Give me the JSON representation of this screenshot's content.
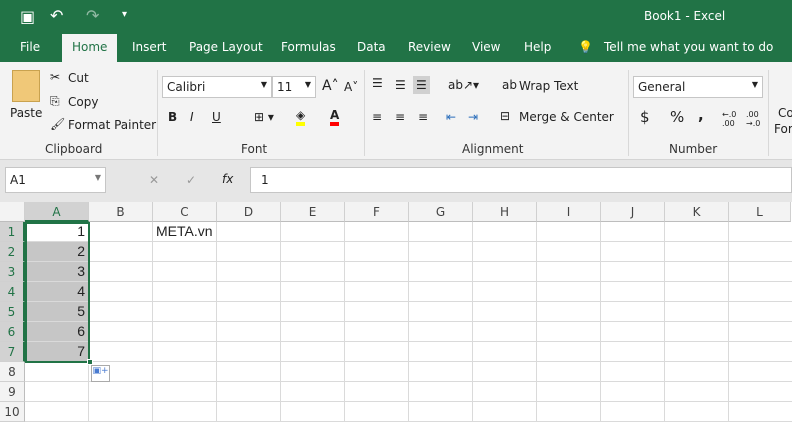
{
  "title": "Book1  -  Excel",
  "qat": {
    "save": "save-icon",
    "undo": "undo-icon",
    "redo": "redo-icon",
    "customize": "▾"
  },
  "tabs": [
    "File",
    "Home",
    "Insert",
    "Page Layout",
    "Formulas",
    "Data",
    "Review",
    "View",
    "Help"
  ],
  "tell_me": "Tell me what you want to do",
  "clipboard": {
    "paste": "Paste",
    "cut": "Cut",
    "copy": "Copy",
    "format_painter": "Format Painter",
    "label": "Clipboard"
  },
  "font": {
    "name": "Calibri",
    "size": "11",
    "label": "Font",
    "bold": "B",
    "italic": "I",
    "underline": "U",
    "fill_color": "#ffff00",
    "font_color": "#ff0000"
  },
  "alignment": {
    "wrap": "Wrap Text",
    "merge": "Merge & Center",
    "label": "Alignment"
  },
  "number": {
    "format": "General",
    "currency": "$",
    "percent": "%",
    "comma": ",",
    "label": "Number",
    "inc": "←.0 .00",
    "dec": ".00 →.0"
  },
  "styles": {
    "cond": "Co",
    "cond2": "For"
  },
  "formula_bar": {
    "name_box": "A1",
    "fx": "fx",
    "value": "1",
    "cancel": "✕",
    "enter": "✓"
  },
  "columns": [
    "A",
    "B",
    "C",
    "D",
    "E",
    "F",
    "G",
    "H",
    "I",
    "J",
    "K",
    "L"
  ],
  "rows": [
    "1",
    "2",
    "3",
    "4",
    "5",
    "6",
    "7",
    "8",
    "9",
    "10"
  ],
  "cells": {
    "A": [
      "1",
      "2",
      "3",
      "4",
      "5",
      "6",
      "7"
    ],
    "C1": "META.vn"
  },
  "accent": "#217346"
}
